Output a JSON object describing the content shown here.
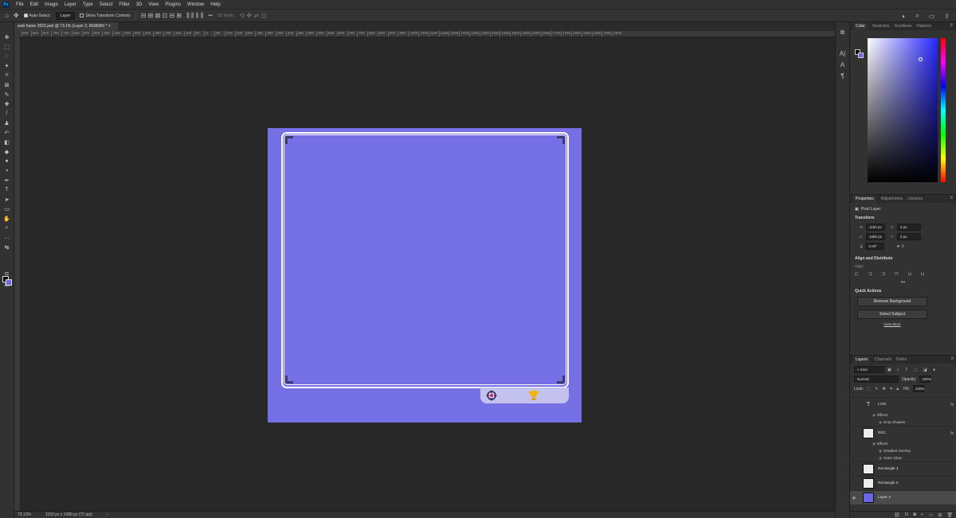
{
  "app": {
    "logo": "Ps"
  },
  "menu": [
    "File",
    "Edit",
    "Image",
    "Layer",
    "Type",
    "Select",
    "Filter",
    "3D",
    "View",
    "Plugins",
    "Window",
    "Help"
  ],
  "options": {
    "auto_select_label": "Auto-Select:",
    "auto_select_value": "Layer",
    "transform_label": "Show Transform Controls",
    "mode_3d": "3D Mode:",
    "more": "•••"
  },
  "document": {
    "tab_title": "web frame 2022.psd @ 73.1% (Layer 2, RGB/8#) *",
    "zoom": "73.13%",
    "doc_size": "1150 px x 1080 px (72 ppi)"
  },
  "ruler_ticks": [
    "900",
    "850",
    "800",
    "750",
    "700",
    "650",
    "600",
    "550",
    "500",
    "450",
    "400",
    "350",
    "300",
    "250",
    "200",
    "150",
    "100",
    "50",
    "0",
    "50",
    "100",
    "150",
    "200",
    "250",
    "300",
    "350",
    "400",
    "450",
    "500",
    "550",
    "600",
    "650",
    "700",
    "750",
    "800",
    "850",
    "900",
    "950",
    "1000",
    "1050",
    "1100",
    "1150",
    "1200",
    "1250",
    "1300",
    "1350",
    "1400",
    "1450",
    "1500",
    "1550",
    "1600",
    "1650",
    "1700",
    "1750",
    "1800",
    "1850",
    "1900",
    "1950",
    "2000"
  ],
  "colors": {
    "foreground": "#000000",
    "background": "#6c67e0",
    "artboard": "#7570e6"
  },
  "color_panel": {
    "tabs": [
      "Color",
      "Swatches",
      "Gradients",
      "Patterns"
    ]
  },
  "properties": {
    "tabs": [
      "Properties",
      "Adjustments",
      "Libraries"
    ],
    "layer_type": "Pixel Layer",
    "transform_title": "Transform",
    "w_label": "W",
    "w_value": "1150 px",
    "h_label": "H",
    "h_value": "1080 px",
    "x_label": "X",
    "x_value": "0 px",
    "y_label": "Y",
    "y_value": "0 px",
    "angle": "0.00°",
    "align_title": "Align and Distribute",
    "align_label": "Align:",
    "quick_actions_title": "Quick Actions",
    "remove_bg": "Remove Background",
    "select_subject": "Select Subject",
    "view_more": "View More"
  },
  "layers_panel": {
    "tabs": [
      "Layers",
      "Channels",
      "Paths"
    ],
    "filter_kind": "Kind",
    "blend_mode": "Normal",
    "opacity_label": "Opacity:",
    "opacity": "100%",
    "lock_label": "Lock:",
    "fill_label": "Fill:",
    "fill": "100%",
    "layers": {
      "live": {
        "name": "LIVE",
        "fx": "fx",
        "effects": "Effects",
        "effect_1": "Drop Shadow"
      },
      "rec": {
        "name": "REC",
        "fx": "fx",
        "effects": "Effects",
        "effect_1": "Gradient Overlay",
        "effect_2": "Outer Glow"
      },
      "rect4": {
        "name": "Rectangle 4"
      },
      "rect5": {
        "name": "Rectangle 5"
      },
      "layer2": {
        "name": "Layer 2"
      }
    }
  }
}
